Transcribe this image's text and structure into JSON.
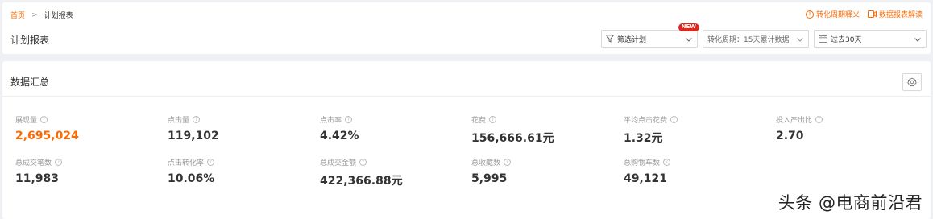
{
  "breadcrumb": {
    "home": "首页",
    "sep": ">",
    "current": "计划报表"
  },
  "help": {
    "conversion": "转化周期释义",
    "report": "数据报表解读"
  },
  "page_title": "计划报表",
  "filters": {
    "plan": "筛选计划",
    "new_badge": "NEW",
    "cycle": "转化周期：15天累计数据",
    "period": "过去30天"
  },
  "summary": {
    "title": "数据汇总",
    "metrics": [
      {
        "label": "展现量",
        "value": "2,695,024",
        "help": true
      },
      {
        "label": "点击量",
        "value": "119,102",
        "help": true
      },
      {
        "label": "点击率",
        "value": "4.42%",
        "help": true
      },
      {
        "label": "花费",
        "value": "156,666.61元",
        "help": true
      },
      {
        "label": "平均点击花费",
        "value": "1.32元",
        "help": true
      },
      {
        "label": "投入产出比",
        "value": "2.70",
        "help": true
      },
      {
        "label": "总成交笔数",
        "value": "11,983",
        "help": true
      },
      {
        "label": "点击转化率",
        "value": "10.06%",
        "help": true
      },
      {
        "label": "总成交金额",
        "value": "422,366.88元",
        "help": true
      },
      {
        "label": "总收藏数",
        "value": "5,995",
        "help": true
      },
      {
        "label": "总购物车数",
        "value": "49,121",
        "help": true
      }
    ]
  },
  "watermark": "头条 @电商前沿君",
  "colors": {
    "accent": "#ff6a00",
    "badge": "#e1251b"
  }
}
